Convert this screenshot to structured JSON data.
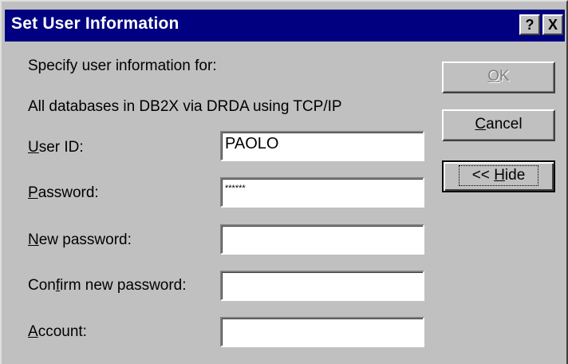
{
  "window": {
    "title": "Set User Information",
    "help_glyph": "?",
    "close_glyph": "X"
  },
  "intro": {
    "line1": "Specify user information for:",
    "line2": "All databases in DB2X via DRDA using TCP/IP"
  },
  "form": {
    "user_id": {
      "label_mnemonic": "U",
      "label_rest": "ser ID:",
      "value": "PAOLO"
    },
    "password": {
      "label_mnemonic": "P",
      "label_rest": "assword:",
      "value": "******"
    },
    "new_password": {
      "label_mnemonic": "N",
      "label_rest": "ew password:",
      "value": ""
    },
    "confirm_password": {
      "label_pre": "Con",
      "label_mnemonic": "f",
      "label_rest": "irm new password:",
      "value": ""
    },
    "account": {
      "label_mnemonic": "A",
      "label_rest": "ccount:",
      "value": ""
    }
  },
  "buttons": {
    "ok": {
      "mnemonic": "O",
      "rest": "K",
      "enabled": false
    },
    "cancel": {
      "mnemonic": "C",
      "rest": "ancel"
    },
    "hide": {
      "pre": "<< ",
      "mnemonic": "H",
      "rest": "ide"
    }
  }
}
